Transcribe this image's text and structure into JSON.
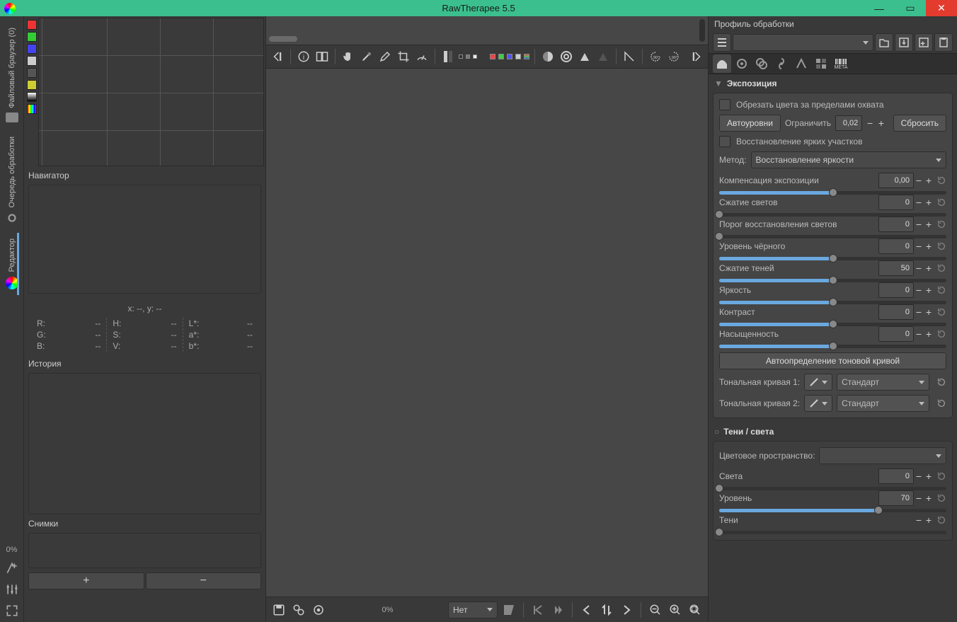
{
  "title": "RawTherapee 5.5",
  "sidebar": {
    "tabs": [
      {
        "label": "Файловый браузер (0)"
      },
      {
        "label": "Очередь обработки"
      },
      {
        "label": "Редактор"
      }
    ]
  },
  "left": {
    "navigator": {
      "title": "Навигатор",
      "xy": "x: --, y: --",
      "cols": [
        [
          {
            "k": "R:",
            "v": "--"
          },
          {
            "k": "G:",
            "v": "--"
          },
          {
            "k": "B:",
            "v": "--"
          }
        ],
        [
          {
            "k": "H:",
            "v": "--"
          },
          {
            "k": "S:",
            "v": "--"
          },
          {
            "k": "V:",
            "v": "--"
          }
        ],
        [
          {
            "k": "L*:",
            "v": "--"
          },
          {
            "k": "a*:",
            "v": "--"
          },
          {
            "k": "b*:",
            "v": "--"
          }
        ]
      ]
    },
    "history": {
      "title": "История"
    },
    "snapshots": {
      "title": "Снимки"
    },
    "percent": "0%"
  },
  "bottom": {
    "percent": "0%",
    "bg": "Нет"
  },
  "right": {
    "profile_header": "Профиль обработки",
    "meta": "META",
    "exposure": {
      "title": "Экспозиция",
      "clip": "Обрезать цвета за пределами охвата",
      "auto": "Автоуровни",
      "limit": "Ограничить",
      "limit_val": "0,02",
      "reset": "Сбросить",
      "hl_recon": "Восстановление ярких участков",
      "method_lbl": "Метод:",
      "method_val": "Восстановление яркости",
      "sliders": [
        {
          "label": "Компенсация экспозиции",
          "val": "0,00",
          "pos": 50
        },
        {
          "label": "Сжатие светов",
          "val": "0",
          "pos": 0
        },
        {
          "label": "Порог восстановления светов",
          "val": "0",
          "pos": 0
        },
        {
          "label": "Уровень чёрного",
          "val": "0",
          "pos": 50
        },
        {
          "label": "Сжатие теней",
          "val": "50",
          "pos": 50
        },
        {
          "label": "Яркость",
          "val": "0",
          "pos": 50
        },
        {
          "label": "Контраст",
          "val": "0",
          "pos": 50
        },
        {
          "label": "Насыщенность",
          "val": "0",
          "pos": 50
        }
      ],
      "auto_curve": "Автоопределение тоновой кривой",
      "curve1_lbl": "Тональная кривая 1:",
      "curve1_mode": "Стандарт",
      "curve2_lbl": "Тональная кривая 2:",
      "curve2_mode": "Стандарт"
    },
    "shadows": {
      "title": "Тени / света",
      "colorspace": "Цветовое пространство:",
      "sliders": [
        {
          "label": "Света",
          "val": "0",
          "pos": 0
        },
        {
          "label": "Уровень",
          "val": "70",
          "pos": 70
        },
        {
          "label": "Тени",
          "val": "",
          "pos": 0
        }
      ]
    }
  }
}
